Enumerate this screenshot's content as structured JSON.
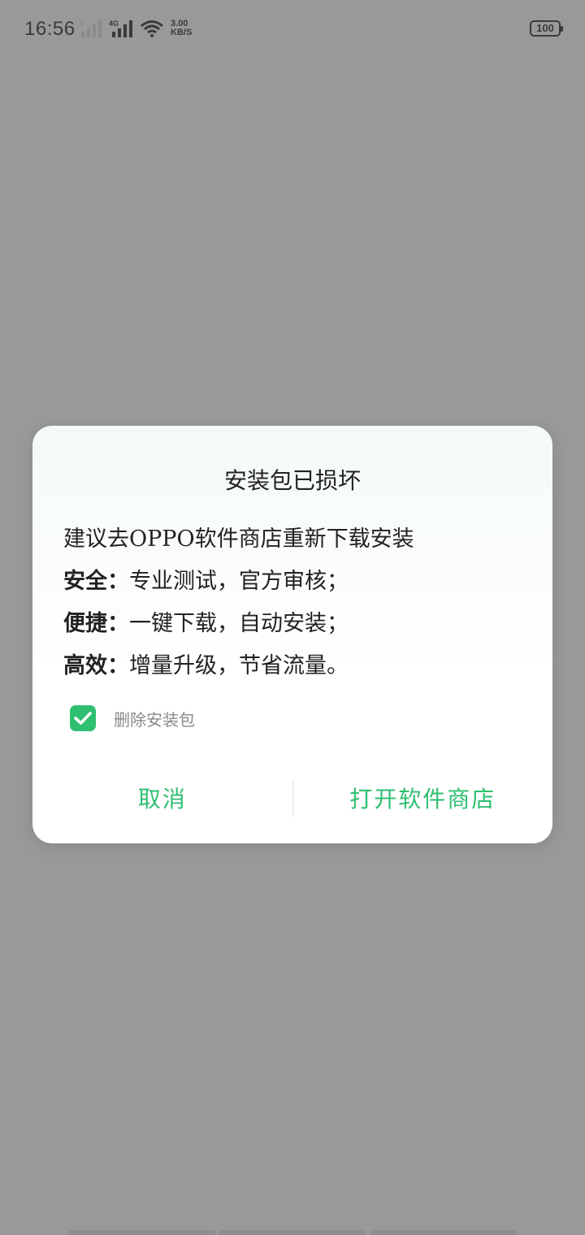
{
  "status_bar": {
    "time": "16:56",
    "network_label": "4G",
    "speed_value": "3.00",
    "speed_unit": "KB/S",
    "battery": "100",
    "icons": [
      "signal-sim1-icon",
      "signal-sim2-icon",
      "wifi-icon",
      "battery-icon"
    ]
  },
  "dialog": {
    "title": "安装包已损坏",
    "intro": "建议去OPPO软件商店重新下载安装",
    "features": [
      {
        "label": "安全：",
        "text": "专业测试，官方审核；"
      },
      {
        "label": "便捷：",
        "text": "一键下载，自动安装；"
      },
      {
        "label": "高效：",
        "text": "增量升级，节省流量。"
      }
    ],
    "checkbox": {
      "checked": true,
      "label": "删除安装包"
    },
    "buttons": {
      "cancel": "取消",
      "open_store": "打开软件商店"
    }
  },
  "colors": {
    "accent": "#2fbf71",
    "overlay": "#999999",
    "dialog_bg": "#ffffff"
  }
}
